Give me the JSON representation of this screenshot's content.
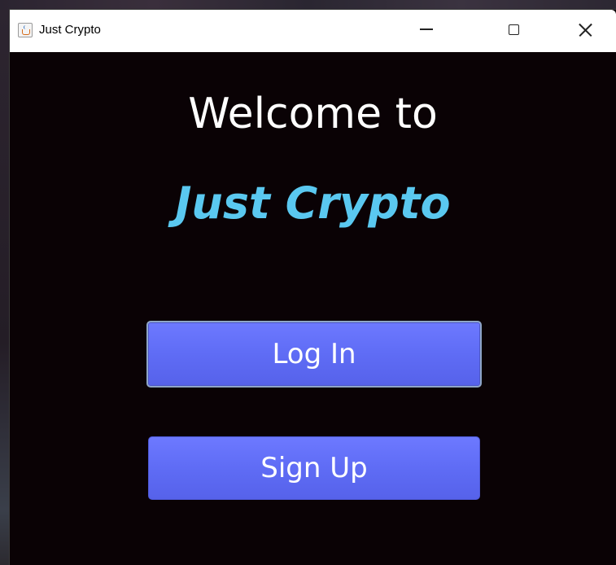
{
  "window": {
    "title": "Just Crypto",
    "icon": "java-cup-icon",
    "controls": {
      "minimize": "minimize-icon",
      "maximize": "maximize-icon",
      "close": "close-icon"
    }
  },
  "main": {
    "welcome_text": "Welcome to",
    "brand_name": "Just Crypto",
    "login_label": "Log In",
    "signup_label": "Sign Up"
  },
  "colors": {
    "background": "#0a0205",
    "brand": "#5ac8f0",
    "button": "#5f6cf5",
    "button_text": "#ffffff"
  }
}
